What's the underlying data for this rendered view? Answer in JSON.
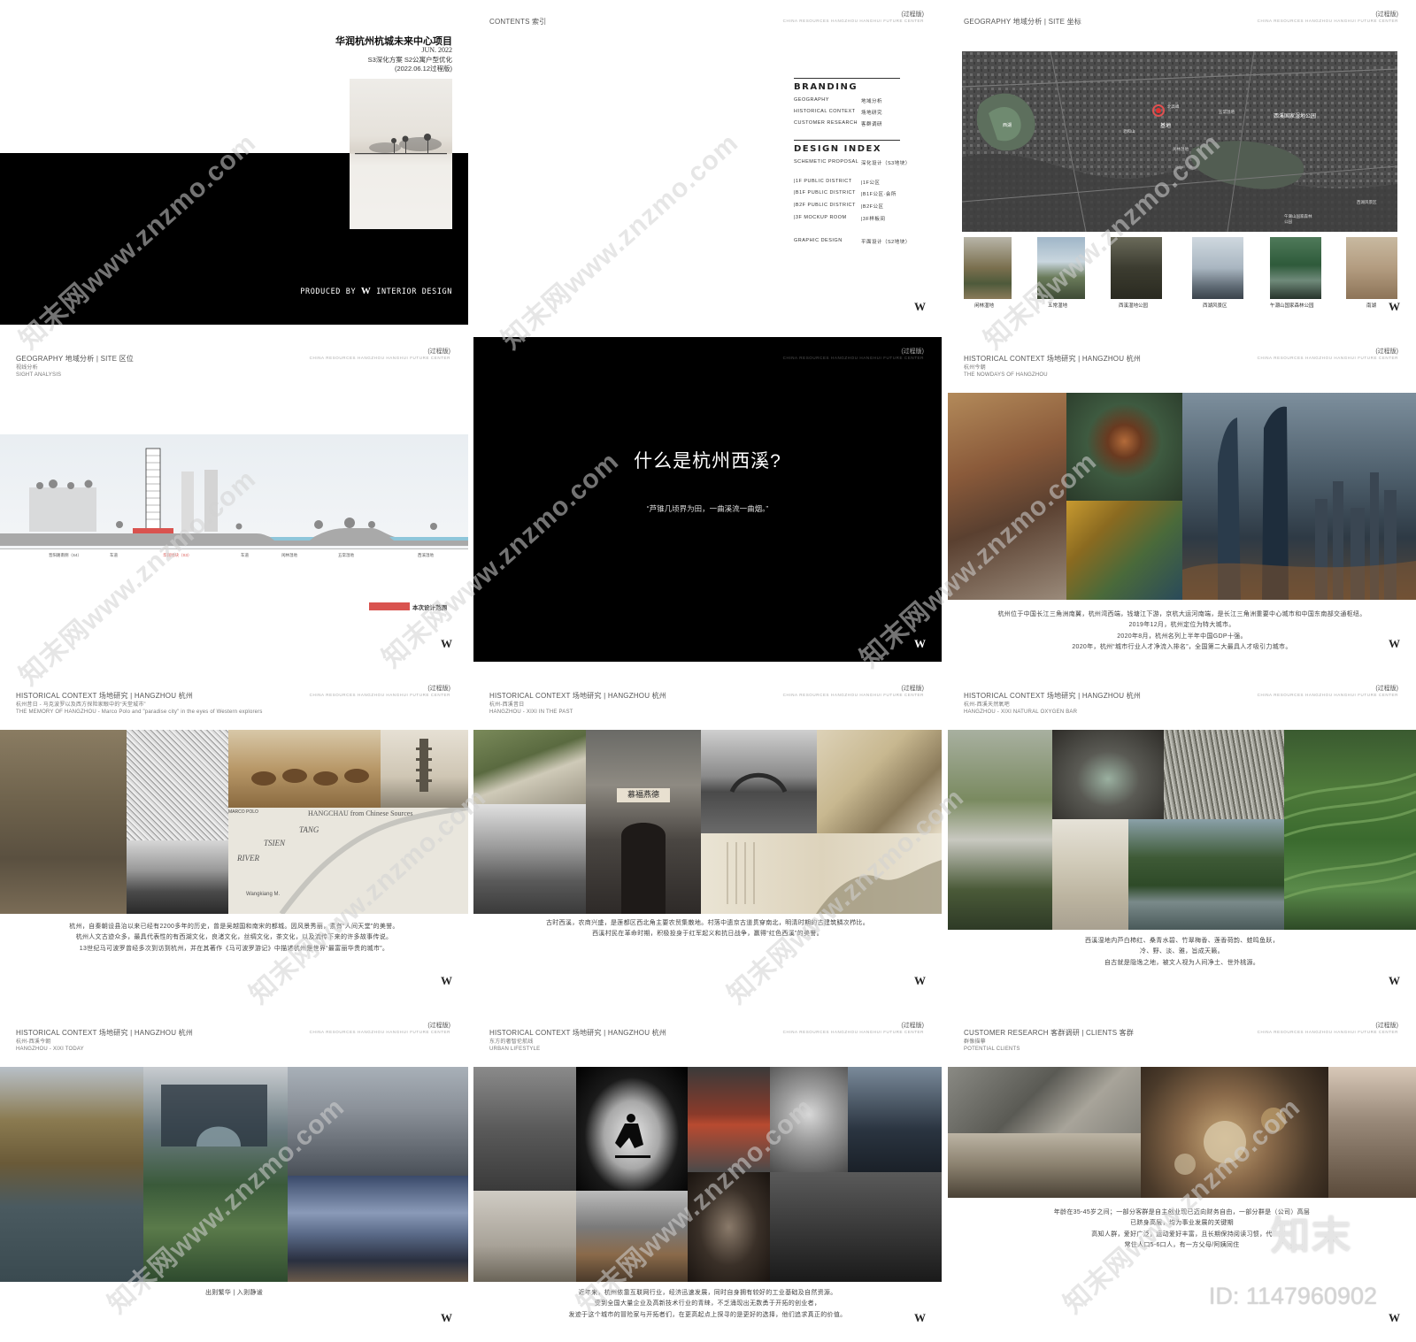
{
  "common": {
    "version_tag": "(过程版)",
    "project_tagline": "CHINA RESOURCES HANGZHOU HANGHUI FUTURE CENTER",
    "logo": "W"
  },
  "cover": {
    "title": "华润杭州杭城未来中心项目",
    "date": "JUN. 2022",
    "subtitle": "S3深化方案  S2公寓户型优化",
    "version": "(2022.06.12过程版)",
    "produced_by": "PRODUCED BY",
    "studio": "INTERIOR DESIGN"
  },
  "contents": {
    "header": "CONTENTS 索引",
    "branding": "BRANDING",
    "branding_items": [
      {
        "en": "GEOGRAPHY",
        "cn": "地域分析"
      },
      {
        "en": "HISTORICAL CONTEXT",
        "cn": "场地研究"
      },
      {
        "en": "CUSTOMER RESEARCH",
        "cn": "客群调研"
      }
    ],
    "design_index": "DESIGN INDEX",
    "schematic": {
      "en": "SCHEMETIC PROPOSAL",
      "cn": "深化设计（S3地块）"
    },
    "design_items": [
      {
        "en": "|1F PUBLIC DISTRICT",
        "cn": "|1F公区"
      },
      {
        "en": "|B1F PUBLIC DISTRICT",
        "cn": "|B1F公区·会所"
      },
      {
        "en": "|B2F PUBLIC DISTRICT",
        "cn": "|B2F公区"
      },
      {
        "en": "|3F MOCKUP ROOM",
        "cn": "|3F样板间"
      }
    ],
    "graphic": {
      "en": "GRAPHIC DESIGN",
      "cn": "平面设计（S2地块）"
    }
  },
  "geo_site": {
    "header": "GEOGRAPHY 地域分析 | SITE 坐标",
    "map_labels": {
      "west_lake": "西湖",
      "site": "基地",
      "xixi": "西溪国家湿地公园",
      "fengjing": "西湖风景区",
      "wuchang": "五常湿地",
      "wanjiashan": "午潮山国家森林公园",
      "hemu": "闲林湿地",
      "beigaofeng": "北高峰",
      "laohe": "老和山"
    },
    "thumbs": [
      "闲林湿地",
      "五常湿地",
      "西溪湿地公园",
      "西湖风景区",
      "午潮山国家森林公园",
      "南湖"
    ]
  },
  "geo_sight": {
    "header": "GEOGRAPHY 地域分析 | SITE 区位",
    "sub_cn": "视线分析",
    "sub_en": "SIGHT ANALYSIS",
    "section_labels": [
      "晋阳路南侧（S4）",
      "车道",
      "华润地块（S3）",
      "车道",
      "闲林湿地",
      "五常湿地",
      "西溪湿地"
    ],
    "legend": "本次设计范围"
  },
  "question": {
    "title": "什么是杭州西溪?",
    "quote": "“芦锥几顷界为田，一曲溪流一曲烟。”"
  },
  "nowadays": {
    "header": "HISTORICAL CONTEXT 场地研究 | HANGZHOU 杭州",
    "sub_cn": "杭州今朝",
    "sub_en": "THE NOWDAYS OF HANGZHOU",
    "captions": [
      "杭州位于中国长江三角洲南翼，杭州湾西端，钱塘江下游，京杭大运河南端，是长江三角洲重要中心城市和中国东南部交通枢纽。",
      "2019年12月，杭州定位为特大城市。",
      "2020年8月，杭州名列上半年中国GDP十强。",
      "2020年，杭州“城市行业人才净流入排名”，全国第二大最具人才吸引力城市。"
    ]
  },
  "memory": {
    "header": "HISTORICAL CONTEXT 场地研究 | HANGZHOU 杭州",
    "sub_cn": "杭州昔日 - 马克波罗以及西方探险家眼中的“天堂城市”",
    "sub_en": "THE MEMORY OF HANGZHOU - Marco Polo and \"paradise city\" in the eyes of Western explorers",
    "captions": [
      "杭州，自秦朝设县治以来已经有2200多年的历史，曾是吴越国和南宋的都城。因风景秀丽，素有“人间天堂”的美誉。",
      "杭州人文古迹众多，最具代表性的有西湖文化，良渚文化，丝绸文化，茶文化，以及流传下来的许多故事传说。",
      "13世纪马可波罗曾经多次到访到杭州，并在其著作《马可波罗游记》中描述杭州是世界“最富丽华贵的城市”。"
    ],
    "map_words": [
      "MARCO POLO",
      "HANGCHAU from Chinese Sources",
      "RIVER",
      "TSIEN",
      "TANG",
      "Wangkiang M."
    ]
  },
  "past": {
    "header": "HISTORICAL CONTEXT 场地研究 | HANGZHOU 杭州",
    "sub_cn": "杭州-西溪昔日",
    "sub_en": "HANGZHOU - XIXI IN THE PAST",
    "sign": "慕福燕德",
    "captions": [
      "古时西溪，农商兴盛，是莲都区西北角主要农贸集散地。村落中遗京古道贯穿南北，明清时期的古建筑鳞次栉比。",
      "西溪村民在革命时期，积极投身于红军起义和抗日战争，赢得“红色西溪”的美誉。"
    ]
  },
  "oxygen": {
    "header": "HISTORICAL CONTEXT 场地研究 | HANGZHOU 杭州",
    "sub_cn": "杭州-西溪天然氧吧",
    "sub_en": "HANGZHOU - XIXI  NATURAL OXYGEN BAR",
    "captions": [
      "西溪湿地内芦白柿红、桑青水碧、竹翠梅香、莲香荷韵、蛙鸣鱼跃，",
      "冷、野、淡、雅，旨成天籁。",
      "自古就是隐逸之地，被文人视为人间净土、世外桃源。"
    ]
  },
  "today": {
    "header": "HISTORICAL CONTEXT 场地研究 | HANGZHOU 杭州",
    "sub_cn": "杭州-西溪今朝",
    "sub_en": "HANGZHOU - XIXI TODAY",
    "caption": "出则繁华  |  入则静谧"
  },
  "lifestyle": {
    "header": "HISTORICAL CONTEXT 场地研究 | HANGZHOU 杭州",
    "sub_cn": "东方的奢智伦航线",
    "sub_en": "URBAN LIFESTYLE",
    "captions": [
      "近年来，杭州依靠互联网行业，经济迅速发展，同时自身拥有较好的工业基础及自然资源。",
      "受到全国大量企业及高新技术行业的青睐，不乏涌现出无数勇于开拓的创业者，",
      "发迹于这个城市的冒险家与开拓者们，在更高起点上探寻的是更好的选择，他们追求真正的价值。"
    ]
  },
  "clients": {
    "header": "CUSTOMER RESEARCH 客群调研 | CLIENTS 客群",
    "sub_cn": "群像描摹",
    "sub_en": "POTENTIAL CLIENTS",
    "captions": [
      "年龄在35-45岁之间；一部分客群是自主创业现已迈向财务自由，一部分群是（公司）高层",
      "已跻身高层，均为事业发展的关键期",
      "高知人群，爱好广泛，运动爱好丰富，且长期保持阅读习惯，代",
      "常住人口5-6口人，有一方父母/阿姨同住"
    ]
  },
  "watermark": {
    "text": "知末网www.znzmo.com",
    "brand": "知末",
    "id": "ID: 1147960902"
  }
}
